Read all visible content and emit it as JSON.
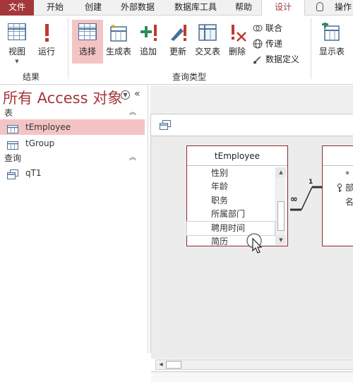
{
  "tabs": [
    {
      "label": "文件",
      "key": "file"
    },
    {
      "label": "开始",
      "key": "home"
    },
    {
      "label": "创建",
      "key": "create"
    },
    {
      "label": "外部数据",
      "key": "external"
    },
    {
      "label": "数据库工具",
      "key": "dbtools"
    },
    {
      "label": "帮助",
      "key": "help"
    },
    {
      "label": "设计",
      "key": "design"
    },
    {
      "label": "操作",
      "key": "tellme"
    }
  ],
  "ribbon": {
    "results": {
      "view": "视图",
      "run": "运行",
      "group": "结果"
    },
    "query_type": {
      "select": "选择",
      "make_table": "生成表",
      "append": "追加",
      "update": "更新",
      "crosstab": "交叉表",
      "delete": "删除",
      "union": "联合",
      "pass_through": "传递",
      "data_definition": "数据定义",
      "group": "查询类型"
    },
    "show_table": "显示表"
  },
  "nav": {
    "title": "所有 Access 对象",
    "sections": [
      {
        "label": "表",
        "items": [
          "tEmployee",
          "tGroup"
        ]
      },
      {
        "label": "查询",
        "items": [
          "qT1"
        ]
      }
    ]
  },
  "query": {
    "table1": {
      "name": "tEmployee",
      "fields": [
        "性别",
        "年龄",
        "职务",
        "所属部门",
        "聘用时间",
        "简历"
      ]
    },
    "table2": {
      "fields": [
        "*",
        "部",
        "名"
      ]
    },
    "relationship": {
      "one": "1",
      "many": "∞"
    }
  },
  "colors": {
    "accent": "#a4373a",
    "selected": "#f4c4c4"
  }
}
